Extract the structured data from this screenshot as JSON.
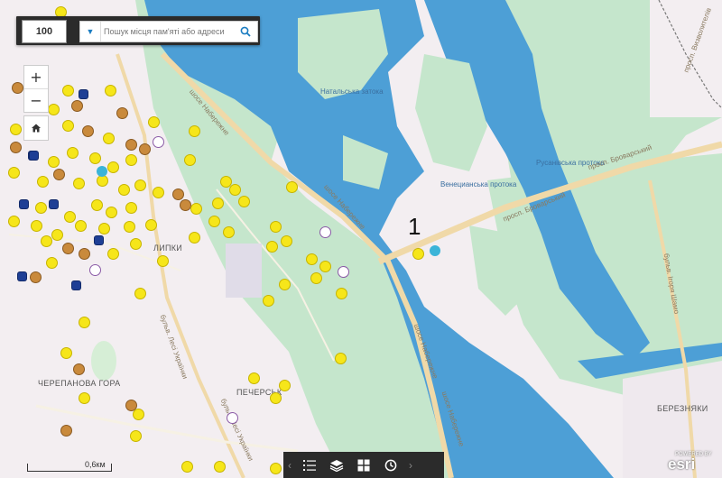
{
  "search": {
    "placeholder": "Пошук місця пам'яті або адреси",
    "logo_text": "100"
  },
  "zoom": {
    "in_label": "+",
    "out_label": "−"
  },
  "annotation": {
    "text": "1"
  },
  "labels": {
    "natalka": "Натальська затока",
    "venetsianska": "Венецианська протока",
    "rusanivska": "Русанівська протока",
    "brovarsky_1": "просп. Броварський",
    "brovarsky_2": "просп. Броварський",
    "naberezhne_1": "шосе Набережне",
    "naberezhne_2": "шосе Набережне",
    "naberezhne_3": "шосе Набережне",
    "naberezhne_4": "шосе Набережне",
    "lesya": "бульв. Лесі Українки",
    "lesya2": "бульв. Лесі Українки",
    "shevchenka": "бульв. Ігоря Шамо",
    "vyzvolyteliv": "просп. Визволителів",
    "lypky": "ЛИПКИ",
    "cherepanova": "ЧЕРЕПАНОВА ГОРА",
    "pechersk": "ПЕЧЕРСЬК",
    "bereznyaky": "БЕРЕЗНЯКИ"
  },
  "scale": {
    "label": "0,6км"
  },
  "attribution": {
    "esri": "esri",
    "powered": "POWERED BY"
  },
  "toolbar": {
    "items": [
      "list-icon",
      "layers-icon",
      "basemap-gallery-icon",
      "history-icon"
    ]
  },
  "colors": {
    "water": "#4d9fd6",
    "park": "#c5e6cc",
    "urban": "#f3eef1",
    "road": "#f0d9a8",
    "marker_yellow": "#f6e61a",
    "marker_brown": "#c98a3c",
    "marker_blue": "#1e3f95",
    "toolbar": "#2b2b2b"
  }
}
